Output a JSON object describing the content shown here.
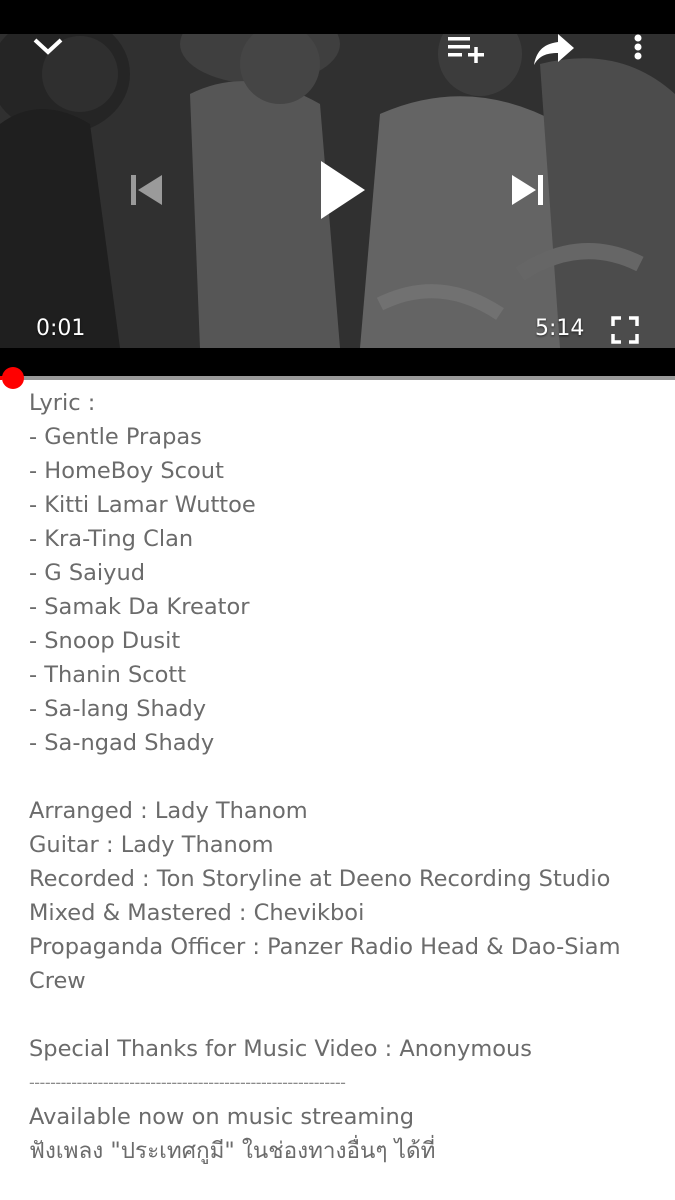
{
  "player": {
    "current_time": "0:01",
    "duration": "5:14",
    "progress_fraction": 0.003,
    "accent_color": "#ff0000",
    "icons": {
      "minimize": "chevron-down-icon",
      "add_to_playlist": "playlist-add-icon",
      "share": "share-arrow-icon",
      "more": "more-vertical-icon",
      "previous": "skip-previous-icon",
      "play": "play-icon",
      "next": "skip-next-icon",
      "fullscreen": "fullscreen-icon"
    }
  },
  "description": {
    "lyric_header": "Lyric :",
    "lyricists": [
      "- Gentle Prapas",
      "- HomeBoy Scout",
      "- Kitti Lamar Wuttoe",
      "- Kra-Ting Clan",
      "- G Saiyud",
      "- Samak Da Kreator",
      "- Snoop Dusit",
      "- Thanin Scott",
      "- Sa-lang Shady",
      "- Sa-ngad Shady"
    ],
    "credits": [
      "Arranged : Lady Thanom",
      "Guitar : Lady Thanom",
      "Recorded : Ton Storyline at Deeno Recording Studio",
      "Mixed & Mastered : Chevikboi",
      "Propaganda Officer : Panzer Radio Head & Dao-Siam Crew"
    ],
    "special_thanks": "Special Thanks for Music Video : Anonymous",
    "separator": "------------------------------------------------------------",
    "available_now": "Available now on music streaming",
    "thai_listen": "ฟังเพลง \"ประเทศกูมี\" ในช่องทางอื่นๆ ได้ที่"
  }
}
